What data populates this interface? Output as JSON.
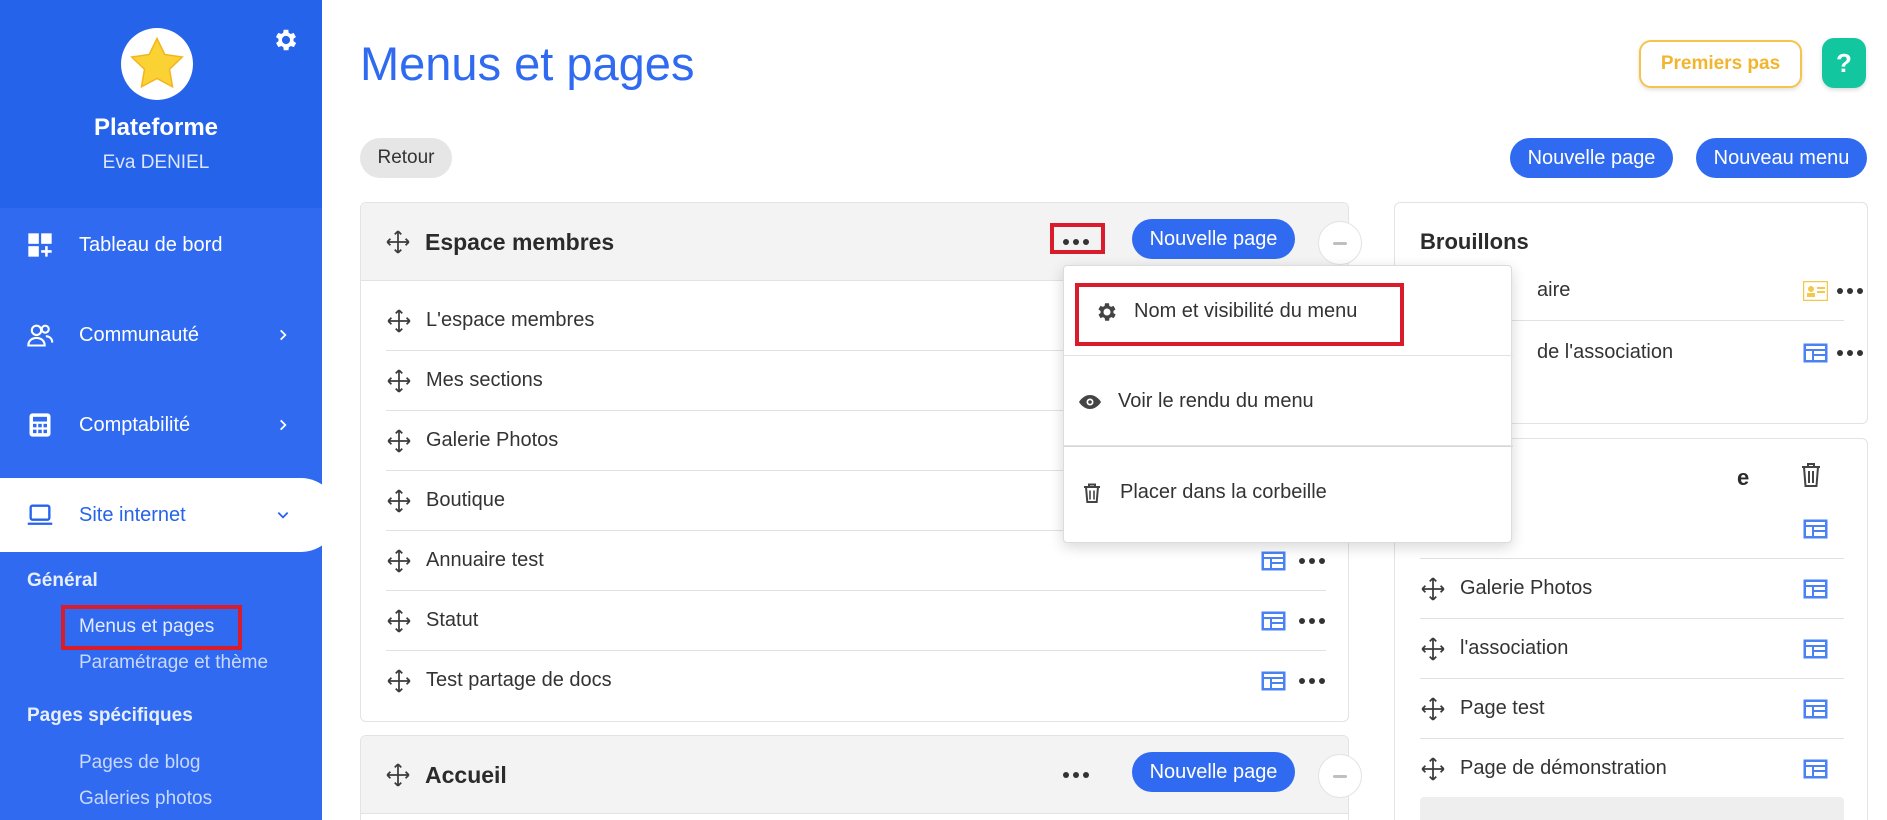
{
  "sidebar": {
    "org_name": "Plateforme",
    "user_name": "Eva DENIEL",
    "nav": [
      {
        "label": "Tableau de bord",
        "icon": "dashboard-icon"
      },
      {
        "label": "Communauté",
        "icon": "users-icon"
      },
      {
        "label": "Comptabilité",
        "icon": "calculator-icon"
      },
      {
        "label": "Site internet",
        "icon": "laptop-icon",
        "active": true
      }
    ],
    "section_general": "Général",
    "general_links": [
      "Menus et pages",
      "Paramétrage et thème"
    ],
    "section_specific": "Pages spécifiques",
    "specific_links": [
      "Pages de blog",
      "Galeries photos"
    ]
  },
  "header": {
    "title": "Menus et pages",
    "first_steps": "Premiers pas",
    "help": "?"
  },
  "toolbar": {
    "back": "Retour",
    "new_page": "Nouvelle page",
    "new_menu": "Nouveau menu"
  },
  "menu_espace": {
    "title": "Espace membres",
    "new_page": "Nouvelle page",
    "pages": [
      "L'espace membres",
      "Mes sections",
      "Galerie Photos",
      "Boutique",
      "Annuaire test",
      "Statut",
      "Test partage de docs"
    ]
  },
  "menu_accueil": {
    "title": "Accueil",
    "new_page": "Nouvelle page"
  },
  "dropdown": {
    "items": [
      "Nom et visibilité du menu",
      "Voir le rendu du menu",
      "Placer dans la corbeille"
    ]
  },
  "drafts": {
    "title": "Brouillons",
    "items": [
      "aire",
      "de l'association"
    ]
  },
  "second_panel": {
    "title_fragment": "e",
    "items": [
      "Galerie Photos",
      "l'association",
      "Page test",
      "Page de démonstration"
    ]
  },
  "colors": {
    "primary": "#2f6af0",
    "highlight": "#d91c2b",
    "help": "#12c6a0",
    "first_steps": "#f2b530"
  }
}
